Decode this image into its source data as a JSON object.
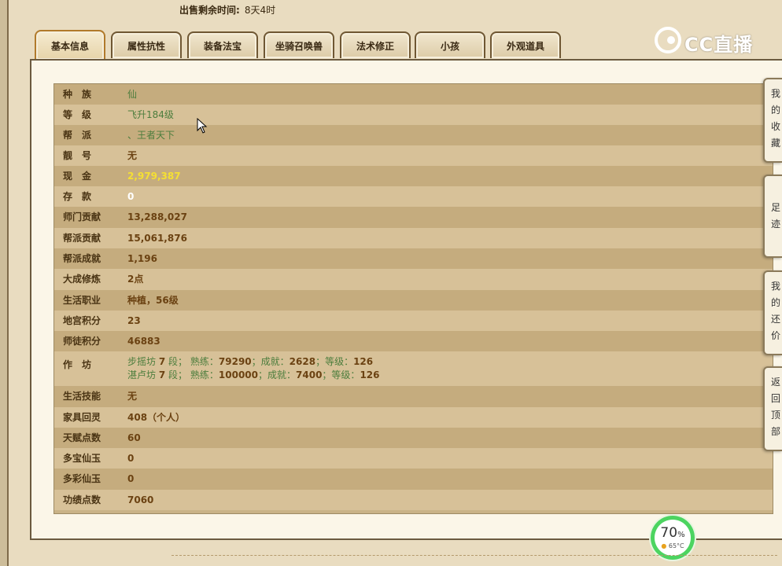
{
  "header": {
    "sale_label": "出售剩余时间:",
    "sale_value": "8天4时"
  },
  "tabs": [
    {
      "label": "基本信息",
      "active": true
    },
    {
      "label": "属性抗性"
    },
    {
      "label": "装备法宝"
    },
    {
      "label": "坐骑召唤兽"
    },
    {
      "label": "法术修正"
    },
    {
      "label": "小孩"
    },
    {
      "label": "外观道具"
    }
  ],
  "logo": {
    "text": "CC直播",
    "icon": "cc-logo-icon"
  },
  "info": {
    "race": {
      "label": "种　族",
      "value": "仙"
    },
    "level": {
      "label": "等　级",
      "value": "飞升184级"
    },
    "gang": {
      "label": "帮　派",
      "value": "、王者天下"
    },
    "pretty_id": {
      "label": "靓　号",
      "value": "无"
    },
    "cash": {
      "label": "现　金",
      "value": "2,979,387"
    },
    "deposit": {
      "label": "存　款",
      "value": "0"
    },
    "school_contrib": {
      "label": "师门贡献",
      "value": "13,288,027"
    },
    "gang_contrib": {
      "label": "帮派贡献",
      "value": "15,061,876"
    },
    "gang_achieve": {
      "label": "帮派成就",
      "value": "1,196"
    },
    "dacheng": {
      "label": "大成修炼",
      "value": "2点"
    },
    "life_job": {
      "label": "生活职业",
      "value": "种植，56级"
    },
    "palace_score": {
      "label": "地宫积分",
      "value": "23"
    },
    "mentor_score": {
      "label": "师徒积分",
      "value": "46883"
    },
    "workshop": {
      "label": "作　坊",
      "lines": [
        {
          "name": "步摇坊",
          "seg": "7",
          "seg_unit": "段；",
          "skill_label": "熟练：",
          "skill": "79290",
          "ach_label": "；成就：",
          "ach": "2628",
          "lv_label": "；等级：",
          "lv": "126"
        },
        {
          "name": "湛卢坊",
          "seg": "7",
          "seg_unit": "段；",
          "skill_label": "熟练：",
          "skill": "100000",
          "ach_label": "；成就：",
          "ach": "7400",
          "lv_label": "；等级：",
          "lv": "126"
        }
      ]
    },
    "life_skill": {
      "label": "生活技能",
      "value": "无"
    },
    "furniture": {
      "label": "家具回灵",
      "value": "408（个人）"
    },
    "talent": {
      "label": "天赋点数",
      "value": "60"
    },
    "duobao": {
      "label": "多宝仙玉",
      "value": "0"
    },
    "duocai": {
      "label": "多彩仙玉",
      "value": "0"
    },
    "merit": {
      "label": "功绩点数",
      "value": "7060"
    }
  },
  "side_buttons": [
    "我的收藏",
    "足迹",
    "我的还价",
    "返回顶部"
  ],
  "gauge": {
    "percent": "70",
    "percent_unit": "%",
    "temp": "65°C"
  },
  "colors": {
    "panel_bg": "#fbf6e8",
    "row_dark": "#c5ac7e",
    "row_light": "#d7c198",
    "green_text": "#4c7d3d",
    "cash_yellow": "#f5e033"
  }
}
